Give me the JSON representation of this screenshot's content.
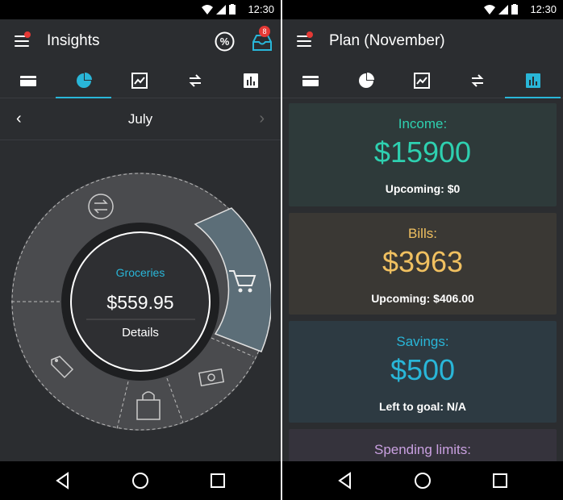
{
  "colors": {
    "accent": "#29b6d8",
    "income": "#2ed0b0",
    "bills": "#f0c060",
    "savings": "#29b6d8",
    "limits": "#c9a0e0",
    "badge": "#e53935"
  },
  "left": {
    "status_time": "12:30",
    "title": "Insights",
    "badge_count": "8",
    "month": "July",
    "center": {
      "category": "Groceries",
      "amount": "$559.95",
      "details": "Details"
    }
  },
  "right": {
    "status_time": "12:30",
    "title": "Plan (November)",
    "cards": {
      "income": {
        "label": "Income:",
        "amount": "$15900",
        "sub": "Upcoming: $0"
      },
      "bills": {
        "label": "Bills:",
        "amount": "$3963",
        "sub": "Upcoming: $406.00"
      },
      "savings": {
        "label": "Savings:",
        "amount": "$500",
        "sub": "Left to goal: N/A"
      },
      "limits": {
        "label": "Spending limits:"
      }
    }
  },
  "icons": {
    "tabs": [
      "card-icon",
      "pie-chart-icon",
      "line-chart-icon",
      "transfer-icon",
      "bar-chart-icon"
    ],
    "nav": [
      "back-icon",
      "home-icon",
      "recents-icon"
    ]
  }
}
